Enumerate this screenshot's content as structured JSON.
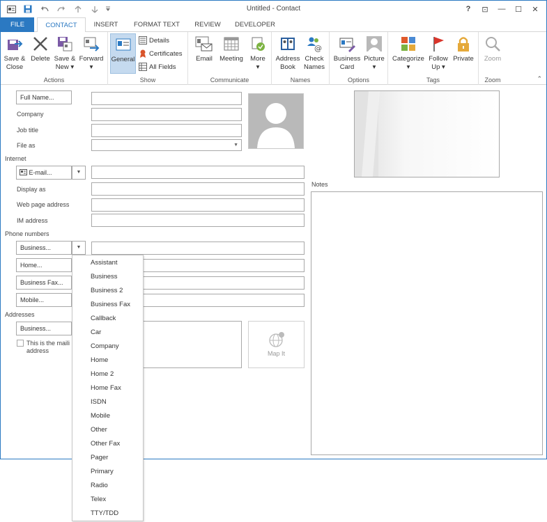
{
  "window": {
    "title": "Untitled - Contact"
  },
  "title_controls": {
    "help": "?",
    "restore_ribbon": "⊡",
    "minimize": "—",
    "maximize": "☐",
    "close": "✕"
  },
  "tabs": [
    {
      "label": "FILE"
    },
    {
      "label": "CONTACT"
    },
    {
      "label": "INSERT"
    },
    {
      "label": "FORMAT TEXT"
    },
    {
      "label": "REVIEW"
    },
    {
      "label": "DEVELOPER"
    }
  ],
  "ribbon": {
    "actions": {
      "label": "Actions",
      "save_close": [
        "Save &",
        "Close"
      ],
      "delete": "Delete",
      "save_new": [
        "Save &",
        "New ▾"
      ],
      "forward": [
        "Forward",
        "▾"
      ]
    },
    "show": {
      "label": "Show",
      "general": "General",
      "details": "Details",
      "certificates": "Certificates",
      "all_fields": "All Fields"
    },
    "communicate": {
      "label": "Communicate",
      "email": "Email",
      "meeting": "Meeting",
      "more": [
        "More",
        "▾"
      ]
    },
    "names": {
      "label": "Names",
      "address_book": [
        "Address",
        "Book"
      ],
      "check_names": [
        "Check",
        "Names"
      ]
    },
    "options": {
      "label": "Options",
      "business_card": [
        "Business",
        "Card"
      ],
      "picture": [
        "Picture",
        "▾"
      ]
    },
    "tags": {
      "label": "Tags",
      "categorize": [
        "Categorize",
        "▾"
      ],
      "follow_up": [
        "Follow",
        "Up ▾"
      ],
      "private": "Private"
    },
    "zoom": {
      "label": "Zoom",
      "zoom": "Zoom"
    },
    "collapse": "⌃"
  },
  "colors": {
    "accent": "#2b79c2",
    "selected_bg": "#c5daef"
  },
  "form": {
    "full_name_btn": "Full Name...",
    "company": "Company",
    "job_title": "Job title",
    "file_as": "File as",
    "internet": "Internet",
    "email_btn": "E-mail...",
    "display_as": "Display as",
    "web_page": "Web page address",
    "im_address": "IM address",
    "phone_numbers": "Phone numbers",
    "business_phone_btn": "Business...",
    "home_phone_btn": "Home...",
    "business_fax_btn": "Business Fax...",
    "mobile_btn": "Mobile...",
    "addresses": "Addresses",
    "business_addr_btn": "Business...",
    "mailing_check": [
      "This is the maili",
      "address"
    ],
    "map_it": "Map It",
    "notes": "Notes"
  },
  "phone_dropdown": {
    "items": [
      "Assistant",
      "Business",
      "Business 2",
      "Business Fax",
      "Callback",
      "Car",
      "Company",
      "Home",
      "Home 2",
      "Home Fax",
      "ISDN",
      "Mobile",
      "Other",
      "Other Fax",
      "Pager",
      "Primary",
      "Radio",
      "Telex",
      "TTY/TDD"
    ]
  }
}
